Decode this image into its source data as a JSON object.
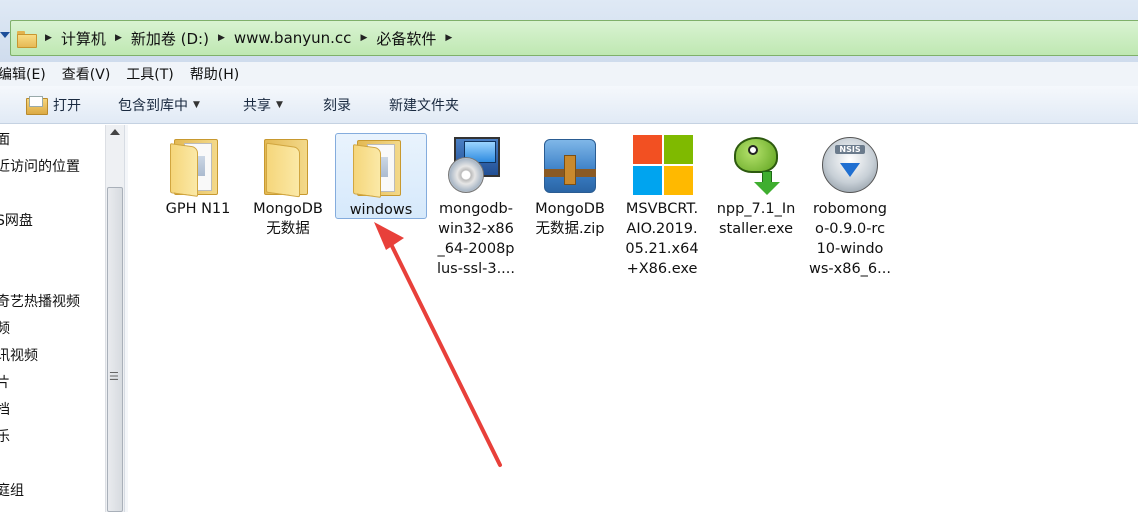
{
  "address_bar": {
    "breadcrumbs": [
      "计算机",
      "新加卷 (D:)",
      "www.banyun.cc",
      "必备软件"
    ],
    "accent_color": "#bfe8b2"
  },
  "menubar": {
    "items": [
      "编辑(E)",
      "查看(V)",
      "工具(T)",
      "帮助(H)"
    ]
  },
  "toolbar": {
    "open_label": "打开",
    "include_label": "包含到库中",
    "share_label": "共享",
    "burn_label": "刻录",
    "new_folder_label": "新建文件夹"
  },
  "navpane": {
    "items": [
      "面",
      "近访问的位置",
      "S网盘",
      "奇艺热播视频",
      "频",
      "讯视频",
      "片",
      "档",
      "乐",
      "庭组"
    ]
  },
  "files": [
    {
      "name": "GPH N11",
      "icon": "folder-icon"
    },
    {
      "name": "MongoDB\n无数据",
      "icon": "folder-icon"
    },
    {
      "name": "windows",
      "icon": "folder-icon",
      "selected": true
    },
    {
      "name": "mongodb-\nwin32-x86\n_64-2008p\nlus-ssl-3....",
      "icon": "installer-icon"
    },
    {
      "name": "MongoDB\n无数据.zip",
      "icon": "zip-archive-icon"
    },
    {
      "name": "MSVBCRT.\nAIO.2019.\n05.21.x64\n+X86.exe",
      "icon": "windows-logo-icon"
    },
    {
      "name": "npp_7.1_In\nstaller.exe",
      "icon": "notepad-plus-plus-icon"
    },
    {
      "name": "robomong\no-0.9.0-rc\n10-windo\nws-x86_6...",
      "icon": "robomongo-installer-icon"
    }
  ],
  "robomongo_badge": "NSIS"
}
